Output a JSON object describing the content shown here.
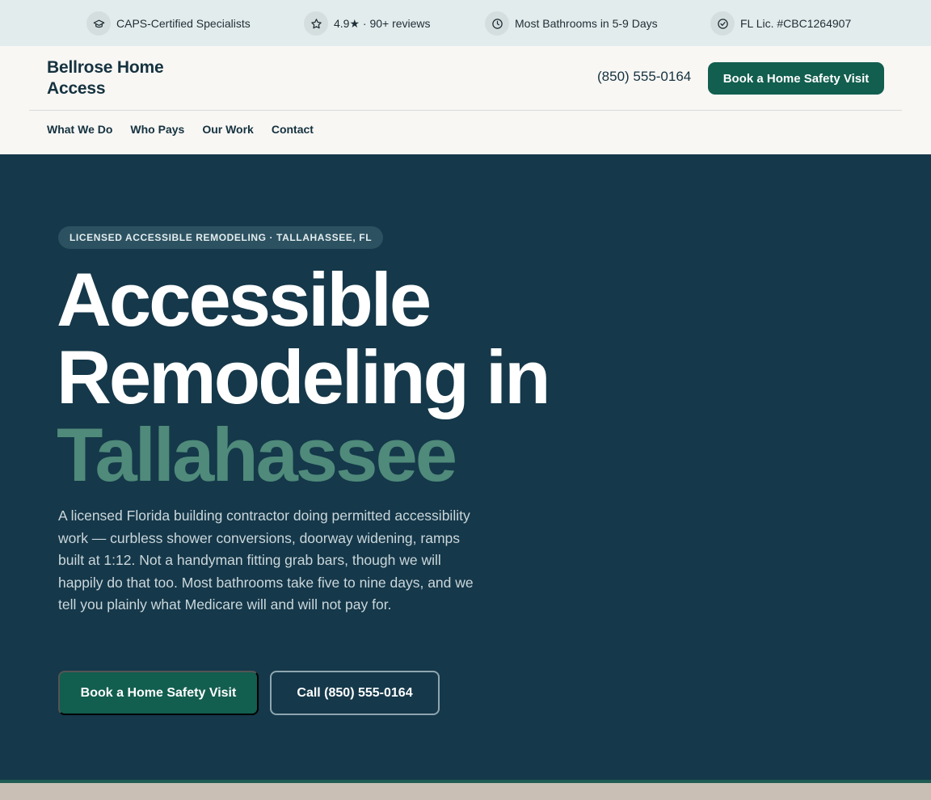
{
  "trustbar": {
    "items": [
      {
        "icon": "graduation-cap-icon",
        "text": "CAPS-Certified Specialists"
      },
      {
        "icon": "star-icon",
        "text": "4.9★ · 90+ reviews"
      },
      {
        "icon": "clock-icon",
        "text": "Most Bathrooms in 5-9 Days"
      },
      {
        "icon": "check-circle-icon",
        "text": "FL Lic. #CBC1264907"
      }
    ]
  },
  "header": {
    "brand": "Bellrose Home Access",
    "phone": "(850) 555-0164",
    "cta_label": "Book a Home Safety Visit",
    "nav": [
      "What We Do",
      "Who Pays",
      "Our Work",
      "Contact"
    ]
  },
  "hero": {
    "eyebrow": "LICENSED ACCESSIBLE REMODELING · TALLAHASSEE, FL",
    "headline_line1": "Accessible",
    "headline_line2": "Remodeling in",
    "headline_accent": "Tallahassee",
    "lead": "A licensed Florida building contractor doing permitted accessibility work — curbless shower conversions, doorway widening, ramps built at 1:12. Not a handyman fitting grab bars, though we will happily do that too. Most bathrooms take five to nine days, and we tell you plainly what Medicare will and will not pay for.",
    "primary_cta": "Book a Home Safety Visit",
    "secondary_cta": "Call (850) 555-0164"
  },
  "colors": {
    "trustbar_bg": "#e3ecec",
    "header_bg": "#f8f7f4",
    "hero_bg": "#15384a",
    "brand_green": "#125e4f",
    "accent_green": "#4f8a7a"
  }
}
